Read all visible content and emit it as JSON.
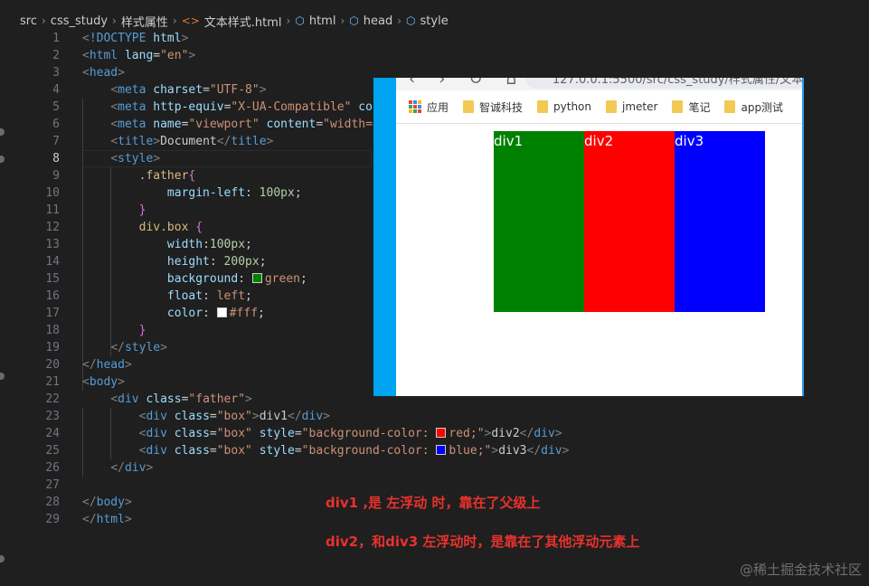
{
  "breadcrumb": [
    "src",
    "css_study",
    "样式属性",
    "文本样式.html",
    "html",
    "head",
    "style"
  ],
  "editor": {
    "active_line": 8,
    "lines": [
      {
        "n": 1,
        "html": "<span class='ang'>&lt;</span><span class='tag'>!DOCTYPE</span> <span class='attr'>html</span><span class='ang'>&gt;</span>"
      },
      {
        "n": 2,
        "html": "<span class='ang'>&lt;</span><span class='tag'>html</span> <span class='attr'>lang</span>=<span class='str'>\"en\"</span><span class='ang'>&gt;</span>"
      },
      {
        "n": 3,
        "html": "<span class='ang'>&lt;</span><span class='tag'>head</span><span class='ang'>&gt;</span>"
      },
      {
        "n": 4,
        "html": "    <span class='ang'>&lt;</span><span class='tag'>meta</span> <span class='attr'>charset</span>=<span class='str'>\"UTF-8\"</span><span class='ang'>&gt;</span>"
      },
      {
        "n": 5,
        "html": "    <span class='ang'>&lt;</span><span class='tag'>meta</span> <span class='attr'>http-equiv</span>=<span class='str'>\"X-UA-Compatible\"</span> <span class='attr'>con</span>"
      },
      {
        "n": 6,
        "html": "    <span class='ang'>&lt;</span><span class='tag'>meta</span> <span class='attr'>name</span>=<span class='str'>\"viewport\"</span> <span class='attr'>content</span>=<span class='str'>\"width=d</span>"
      },
      {
        "n": 7,
        "html": "    <span class='ang'>&lt;</span><span class='tag'>title</span><span class='ang'>&gt;</span>Document<span class='ang'>&lt;/</span><span class='tag'>title</span><span class='ang'>&gt;</span>"
      },
      {
        "n": 8,
        "html": "    <span class='ang'>&lt;</span><span class='tag'>style</span><span class='ang'>&gt;</span>"
      },
      {
        "n": 9,
        "html": "        <span class='sel'>.father</span><span class='brace'>{</span>"
      },
      {
        "n": 10,
        "html": "            <span class='prop'>margin-left</span>: <span class='num'>100px</span>;"
      },
      {
        "n": 11,
        "html": "        <span class='brace'>}</span>"
      },
      {
        "n": 12,
        "html": "        <span class='sel'>div.box</span> <span class='brace'>{</span>"
      },
      {
        "n": 13,
        "html": "            <span class='prop'>width</span>:<span class='num'>100px</span>;"
      },
      {
        "n": 14,
        "html": "            <span class='prop'>height</span>: <span class='num'>200px</span>;"
      },
      {
        "n": 15,
        "html": "            <span class='prop'>background</span>: <span class='swatch' style='background:#008000'></span><span class='str'>green</span>;"
      },
      {
        "n": 16,
        "html": "            <span class='prop'>float</span>: <span class='str'>left</span>;"
      },
      {
        "n": 17,
        "html": "            <span class='prop'>color</span>: <span class='swatch' style='background:#ffffff'></span><span class='str'>#fff</span>;"
      },
      {
        "n": 18,
        "html": "        <span class='brace'>}</span>"
      },
      {
        "n": 19,
        "html": "    <span class='ang'>&lt;/</span><span class='tag'>style</span><span class='ang'>&gt;</span>"
      },
      {
        "n": 20,
        "html": "<span class='ang'>&lt;/</span><span class='tag'>head</span><span class='ang'>&gt;</span>"
      },
      {
        "n": 21,
        "html": "<span class='ang'>&lt;</span><span class='tag'>body</span><span class='ang'>&gt;</span>"
      },
      {
        "n": 22,
        "html": "    <span class='ang'>&lt;</span><span class='tag'>div</span> <span class='attr'>class</span>=<span class='str'>\"father\"</span><span class='ang'>&gt;</span>"
      },
      {
        "n": 23,
        "html": "        <span class='ang'>&lt;</span><span class='tag'>div</span> <span class='attr'>class</span>=<span class='str'>\"box\"</span><span class='ang'>&gt;</span>div1<span class='ang'>&lt;/</span><span class='tag'>div</span><span class='ang'>&gt;</span>"
      },
      {
        "n": 24,
        "html": "        <span class='ang'>&lt;</span><span class='tag'>div</span> <span class='attr'>class</span>=<span class='str'>\"box\"</span> <span class='attr'>style</span>=<span class='str'>\"background-color: </span><span class='swatch' style='background:#ff0000'></span><span class='str'>red;\"</span><span class='ang'>&gt;</span>div2<span class='ang'>&lt;/</span><span class='tag'>div</span><span class='ang'>&gt;</span>"
      },
      {
        "n": 25,
        "html": "        <span class='ang'>&lt;</span><span class='tag'>div</span> <span class='attr'>class</span>=<span class='str'>\"box\"</span> <span class='attr'>style</span>=<span class='str'>\"background-color: </span><span class='swatch' style='background:#0000ff'></span><span class='str'>blue;\"</span><span class='ang'>&gt;</span>div3<span class='ang'>&lt;/</span><span class='tag'>div</span><span class='ang'>&gt;</span>"
      },
      {
        "n": 26,
        "html": "    <span class='ang'>&lt;/</span><span class='tag'>div</span><span class='ang'>&gt;</span>"
      },
      {
        "n": 27,
        "html": ""
      },
      {
        "n": 28,
        "html": "<span class='ang'>&lt;/</span><span class='tag'>body</span><span class='ang'>&gt;</span>"
      },
      {
        "n": 29,
        "html": "<span class='ang'>&lt;/</span><span class='tag'>html</span><span class='ang'>&gt;</span>"
      }
    ]
  },
  "browser": {
    "url": "127.0.0.1:5500/src/css_study/样式属性/文本",
    "bookmarks": [
      "应用",
      "智诚科技",
      "python",
      "jmeter",
      "笔记",
      "app测试"
    ],
    "boxes": [
      {
        "label": "div1",
        "color": "#008000"
      },
      {
        "label": "div2",
        "color": "#ff0000"
      },
      {
        "label": "div3",
        "color": "#0000ff"
      }
    ]
  },
  "notes": [
    "div1 ,是 左浮动 时，靠在了父级上",
    "div2，和div3 左浮动时，是靠在了其他浮动元素上"
  ],
  "watermark": "@稀土掘金技术社区"
}
